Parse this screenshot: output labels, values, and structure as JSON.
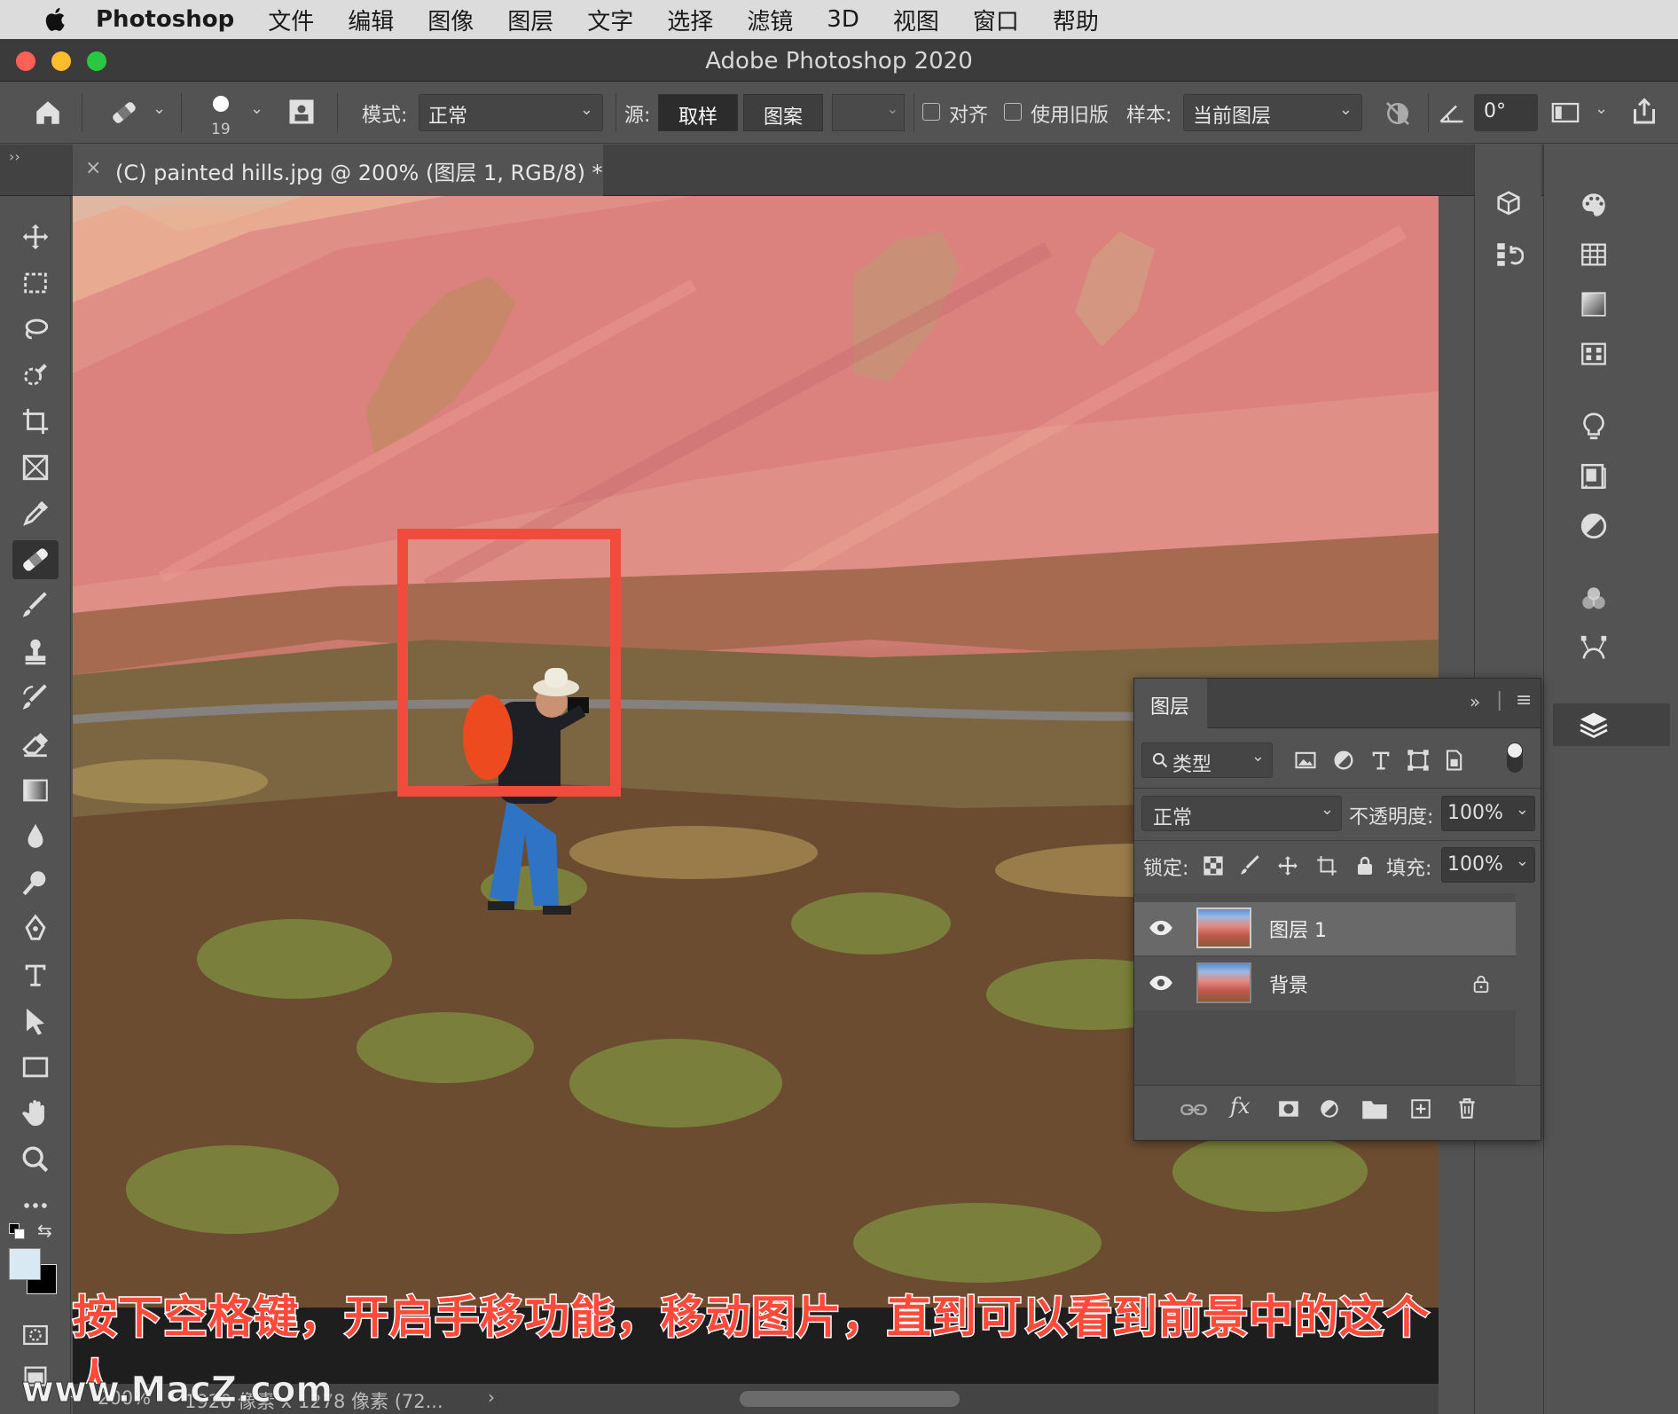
{
  "menubar": {
    "app_name": "Photoshop",
    "items": [
      "文件",
      "编辑",
      "图像",
      "图层",
      "文字",
      "选择",
      "滤镜",
      "3D",
      "视图",
      "窗口",
      "帮助"
    ]
  },
  "window": {
    "title": "Adobe Photoshop 2020",
    "traffic_lights": {
      "close": "#fe5f57",
      "minimize": "#febc2e",
      "zoom": "#28c840"
    }
  },
  "options": {
    "brush_size": "19",
    "mode_label": "模式:",
    "mode_value": "正常",
    "source_label": "源:",
    "source_sampled": "取样",
    "source_pattern": "图案",
    "aligned_label": "对齐",
    "legacy_label": "使用旧版",
    "sample_label": "样本:",
    "sample_value": "当前图层",
    "angle_value": "0°"
  },
  "document": {
    "tab_title": "(C) painted hills.jpg @ 200% (图层 1, RGB/8) *",
    "zoom": "200%",
    "dimensions": "1920 像素 x 1278 像素 (72...",
    "caption": "按下空格键，开启手移功能，移动图片，直到可以看到前景中的这个人",
    "watermark": "www.MacZ.com",
    "highlight_color": "#f14b3d"
  },
  "layers_panel": {
    "title": "图层",
    "filter_label": "类型",
    "blend_mode": "正常",
    "opacity_label": "不透明度:",
    "opacity_value": "100%",
    "lock_label": "锁定:",
    "fill_label": "填充:",
    "fill_value": "100%",
    "layers": [
      {
        "name": "图层 1",
        "visible": true,
        "selected": true,
        "locked": false
      },
      {
        "name": "背景",
        "visible": true,
        "selected": false,
        "locked": true
      }
    ]
  },
  "icons": {
    "accent": "#4a90e2"
  }
}
